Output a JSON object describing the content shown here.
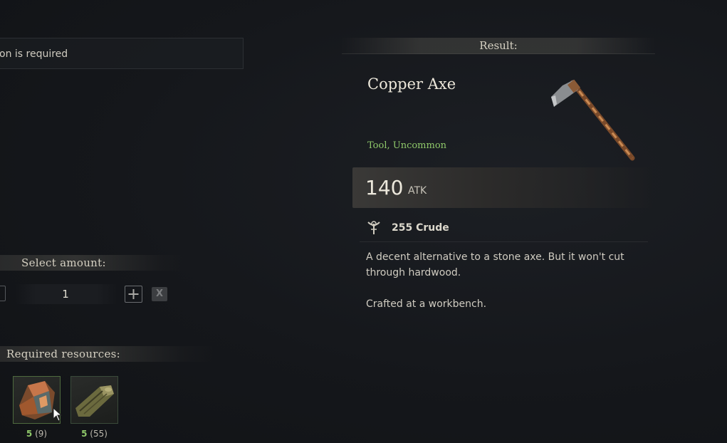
{
  "left_panel": {
    "notice": "on is required",
    "select_amount_label": "Select amount:",
    "amount_value": "1",
    "plus_icon": "plus-icon",
    "clear_label": "X",
    "required_resources_label": "Required resources:",
    "resources": [
      {
        "icon": "copper-ore-icon",
        "need": "5",
        "have": "(9)"
      },
      {
        "icon": "wood-log-icon",
        "need": "5",
        "have": "(55)"
      }
    ]
  },
  "result_panel": {
    "header": "Result:",
    "item_name": "Copper Axe",
    "item_type": "Tool, Uncommon",
    "item_icon": "copper-axe-icon",
    "stat_value": "140",
    "stat_unit": "ATK",
    "quality_icon": "quality-icon",
    "quality_text": "255 Crude",
    "description": [
      "A decent alternative to a stone axe. But it won't cut through hardwood.",
      "Crafted at a workbench."
    ]
  },
  "colors": {
    "accent_green": "#8fc86a",
    "background": "#15171b"
  }
}
